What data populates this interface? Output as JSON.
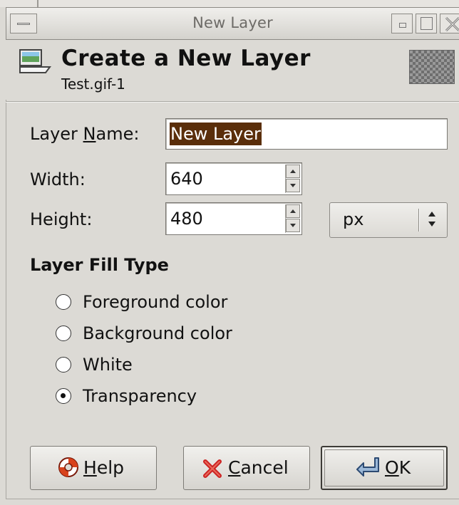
{
  "window": {
    "title": "New Layer"
  },
  "header": {
    "title": "Create a New Layer",
    "subtitle": "Test.gif-1",
    "icon": "new-layer-icon"
  },
  "form": {
    "layer_name_label_pre": "Layer ",
    "layer_name_label_mnemonic": "N",
    "layer_name_label_post": "ame:",
    "layer_name_value": "New Layer",
    "width_label": "Width:",
    "width_value": "640",
    "height_label": "Height:",
    "height_value": "480",
    "unit_value": "px"
  },
  "fill": {
    "title": "Layer Fill Type",
    "options": [
      {
        "label": "Foreground color",
        "checked": false
      },
      {
        "label": "Background color",
        "checked": false
      },
      {
        "label": "White",
        "checked": false
      },
      {
        "label": "Transparency",
        "checked": true
      }
    ]
  },
  "buttons": {
    "help_mnemonic": "H",
    "help_rest": "elp",
    "cancel_mnemonic": "C",
    "cancel_rest": "ancel",
    "ok_mnemonic": "O",
    "ok_rest": "K"
  },
  "colors": {
    "dialog_bg": "#dcdad5",
    "selection_bg": "#5a2e0a",
    "cancel_icon": "#cc2222"
  }
}
